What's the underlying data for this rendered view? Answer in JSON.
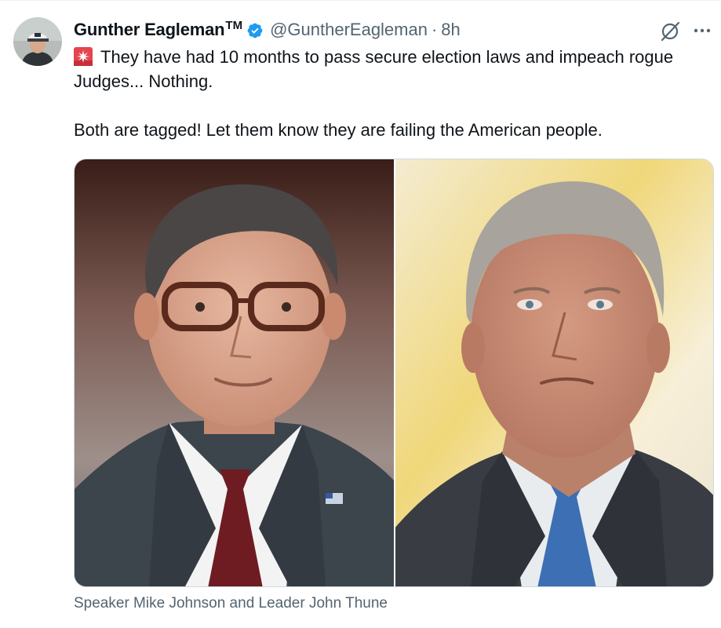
{
  "author": {
    "display_name": "Gunther Eagleman",
    "trademark": "TM",
    "handle": "@GuntherEagleman",
    "separator": "·",
    "time": "8h",
    "verified": true,
    "verified_color": "#1d9bf0"
  },
  "tweet": {
    "line1": "They have had 10 months to pass secure election laws and impeach rogue Judges... Nothing.",
    "line2": "Both are tagged!  Let them know they are failing the American people.",
    "emoji": "rotating-light-siren"
  },
  "media": {
    "caption": "Speaker Mike Johnson and Leader John Thune",
    "panels": [
      "man-with-glasses-portrait",
      "gray-haired-man-portrait"
    ]
  },
  "icons": {
    "grok": "grok-slash-circle-icon",
    "more": "more-options-icon",
    "verified": "verified-badge-icon"
  },
  "colors": {
    "text_primary": "#0f1419",
    "text_secondary": "#536471",
    "accent": "#1d9bf0"
  }
}
